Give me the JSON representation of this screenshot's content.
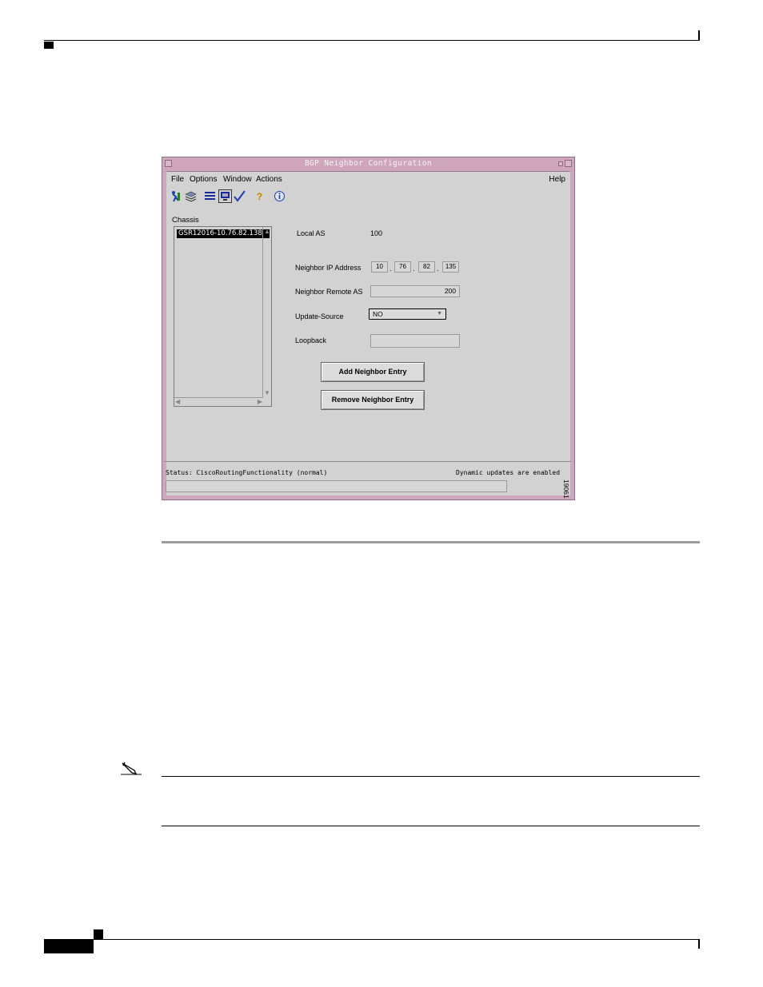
{
  "window": {
    "title": "BGP Neighbor Configuration",
    "menus": [
      "File",
      "Options",
      "Window",
      "Actions"
    ],
    "help_menu": "Help",
    "toolbar_icons": [
      "run-icon",
      "layers-icon",
      "list-icon",
      "monitor-icon",
      "check-icon",
      "help-icon",
      "info-icon"
    ]
  },
  "chassis": {
    "label": "Chassis",
    "items": [
      "GSR12016-10.76.82.138"
    ]
  },
  "form": {
    "local_as_label": "Local AS",
    "local_as_value": "100",
    "neighbor_ip_label": "Neighbor IP Address",
    "ip_octets": [
      "10",
      "76",
      "82",
      "135"
    ],
    "ip_separator": ".",
    "remote_as_label": "Neighbor Remote AS",
    "remote_as_value": "200",
    "update_source_label": "Update-Source",
    "update_source_value": "NO",
    "loopback_label": "Loopback",
    "loopback_value": "",
    "add_button": "Add Neighbor Entry",
    "remove_button": "Remove Neighbor Entry"
  },
  "status": {
    "left": "Status: CiscoRoutingFunctionality (normal)",
    "right": "Dynamic updates are enabled"
  },
  "figure_number": "19061",
  "colors": {
    "title_bar": "#cfa6bb",
    "window_bg": "#d2d2d2"
  }
}
